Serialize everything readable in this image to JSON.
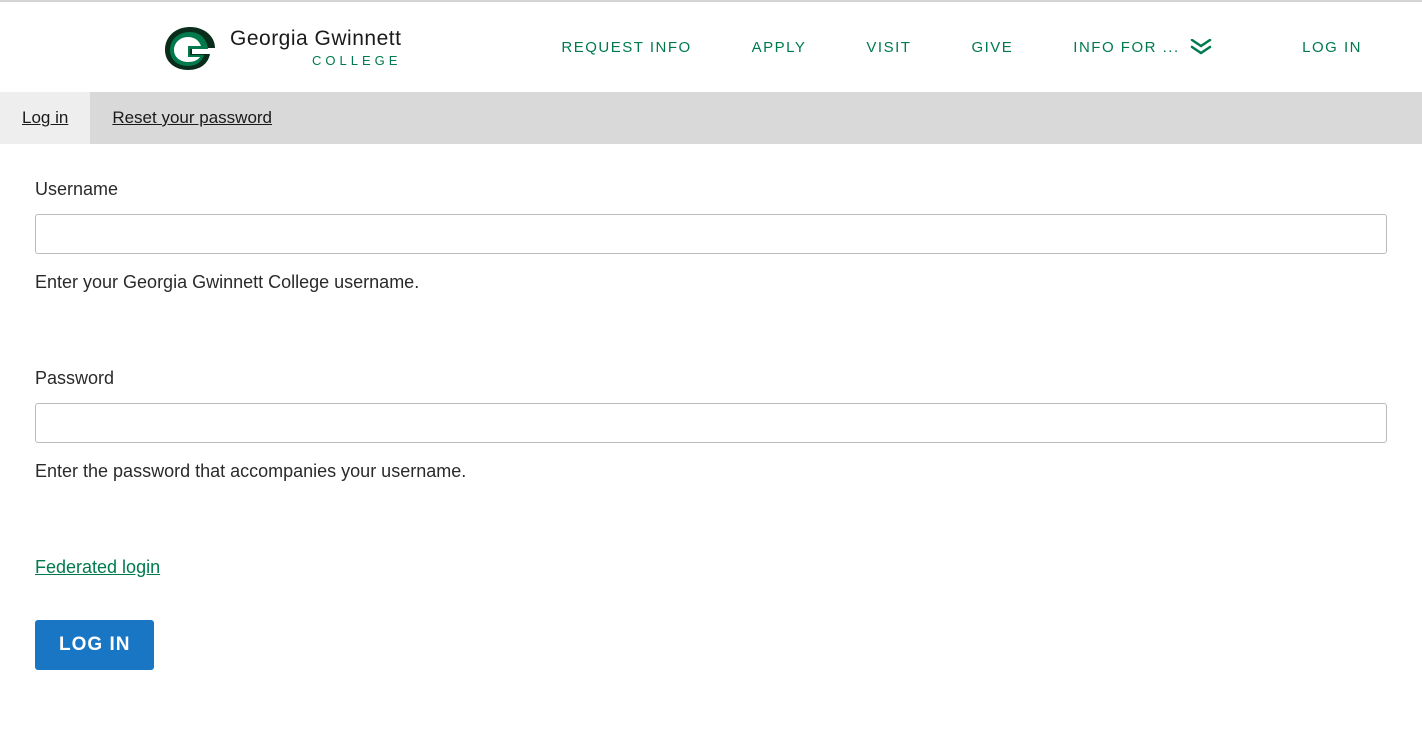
{
  "header": {
    "logo": {
      "main": "Georgia Gwinnett",
      "sub": "COLLEGE"
    },
    "nav": [
      "REQUEST INFO",
      "APPLY",
      "VISIT",
      "GIVE",
      "INFO FOR ..."
    ],
    "login_link": "LOG IN"
  },
  "tabs": {
    "login": "Log in",
    "reset": "Reset your password"
  },
  "form": {
    "username": {
      "label": "Username",
      "help": "Enter your Georgia Gwinnett College username."
    },
    "password": {
      "label": "Password",
      "help": "Enter the password that accompanies your username."
    },
    "federated_link": "Federated login",
    "submit": "LOG IN"
  }
}
